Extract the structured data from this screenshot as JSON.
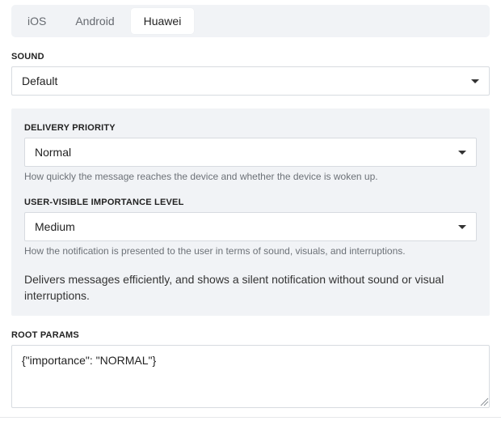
{
  "tabs": [
    {
      "label": "iOS",
      "active": false
    },
    {
      "label": "Android",
      "active": false
    },
    {
      "label": "Huawei",
      "active": true
    }
  ],
  "sound": {
    "label": "SOUND",
    "value": "Default"
  },
  "delivery_priority": {
    "label": "DELIVERY PRIORITY",
    "value": "Normal",
    "help": "How quickly the message reaches the device and whether the device is woken up."
  },
  "importance": {
    "label": "USER-VISIBLE IMPORTANCE LEVEL",
    "value": "Medium",
    "help": "How the notification is presented to the user in terms of sound, visuals, and interruptions.",
    "description": "Delivers messages efficiently, and shows a silent notification without sound or visual interruptions."
  },
  "root_params": {
    "label": "ROOT PARAMS",
    "value": "{\"importance\": \"NORMAL\"}"
  },
  "colors": {
    "panel_bg": "#f1f3f6",
    "border": "#d7dbe0",
    "help_text": "#6c7177"
  }
}
